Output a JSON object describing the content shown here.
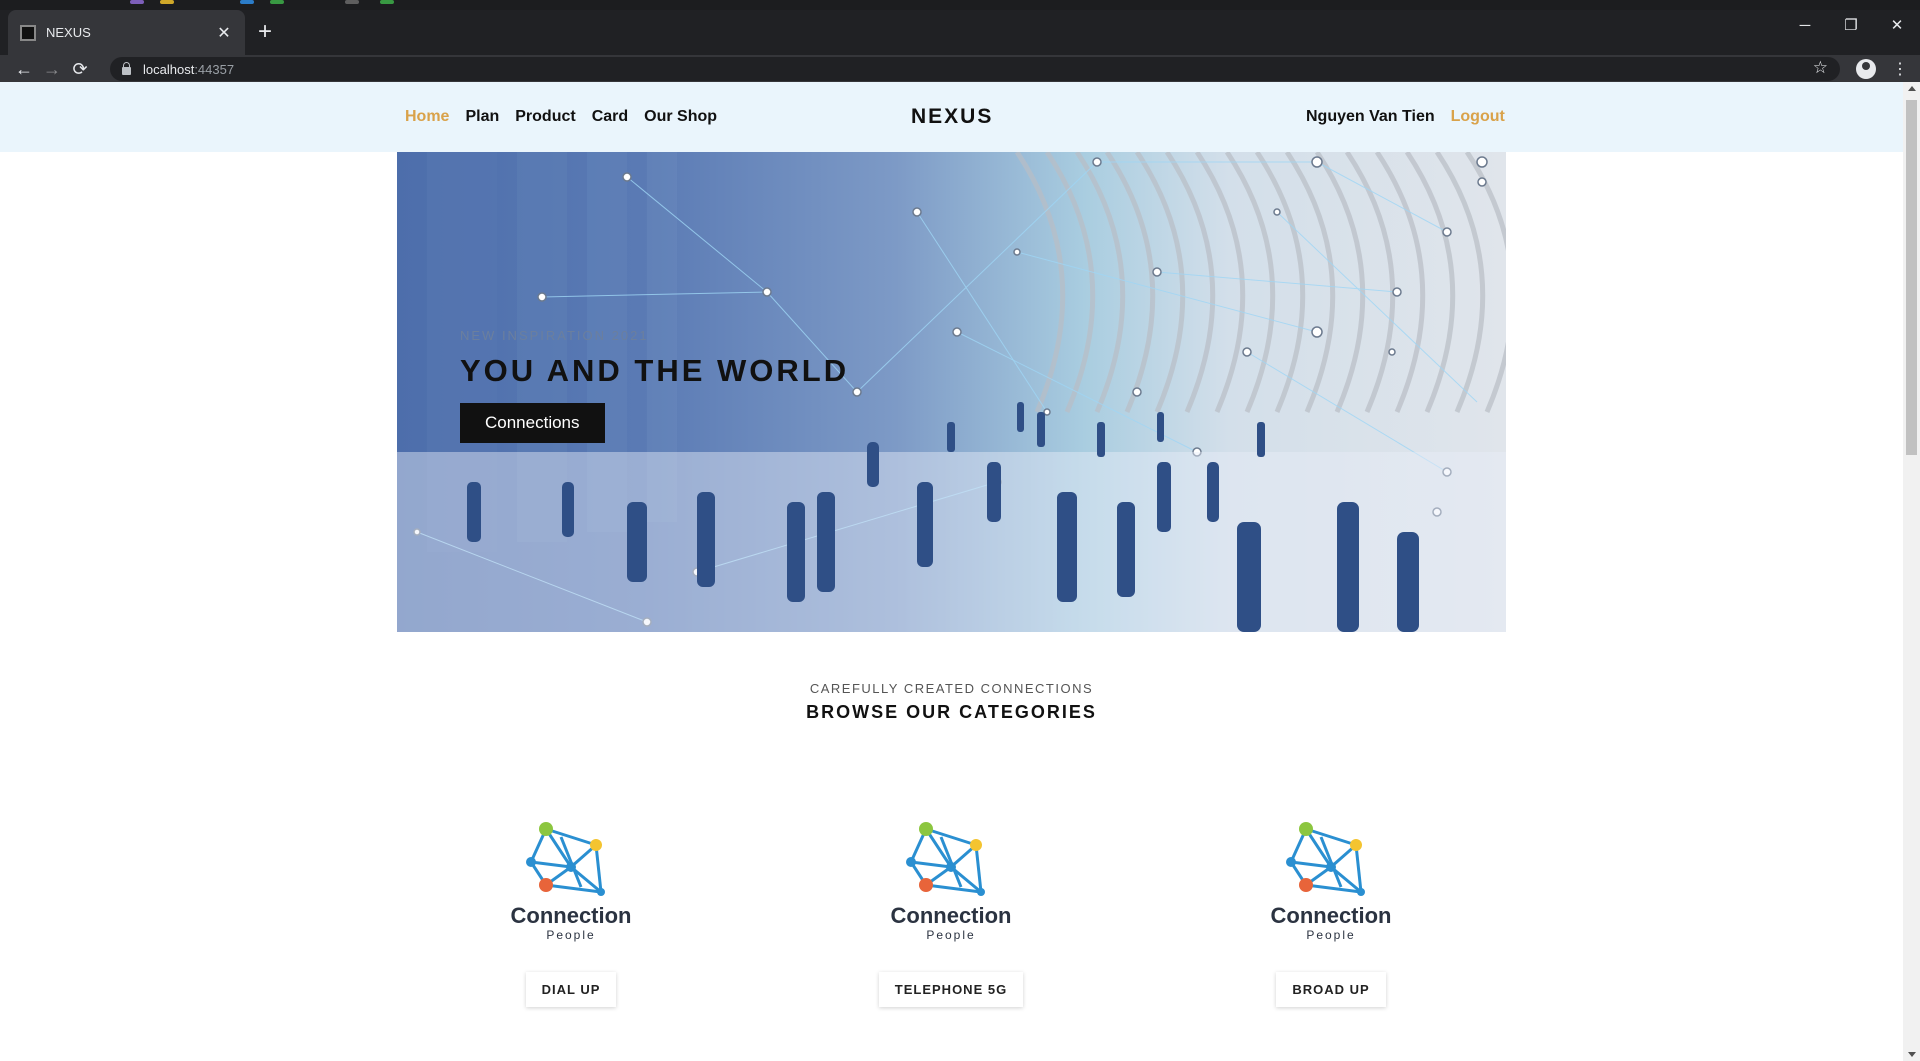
{
  "browser": {
    "tab_title": "NEXUS",
    "url_host": "localhost",
    "url_port": ":44357"
  },
  "site": {
    "brand": "NEXUS",
    "nav_left": [
      "Home",
      "Plan",
      "Product",
      "Card",
      "Our Shop"
    ],
    "user_name": "Nguyen Van Tien",
    "logout": "Logout",
    "accent_color": "#d9a24a"
  },
  "hero": {
    "kicker": "NEW INSPIRATION 2021",
    "title": "YOU AND THE WORLD",
    "button": "Connections"
  },
  "categories": {
    "kicker": "CAREFULLY CREATED CONNECTIONS",
    "title": "BROWSE OUR CATEGORIES",
    "logo_line1": "Connection",
    "logo_line2": "People",
    "items": [
      {
        "label": "DIAL UP"
      },
      {
        "label": "TELEPHONE 5G"
      },
      {
        "label": "BROAD UP"
      }
    ]
  }
}
